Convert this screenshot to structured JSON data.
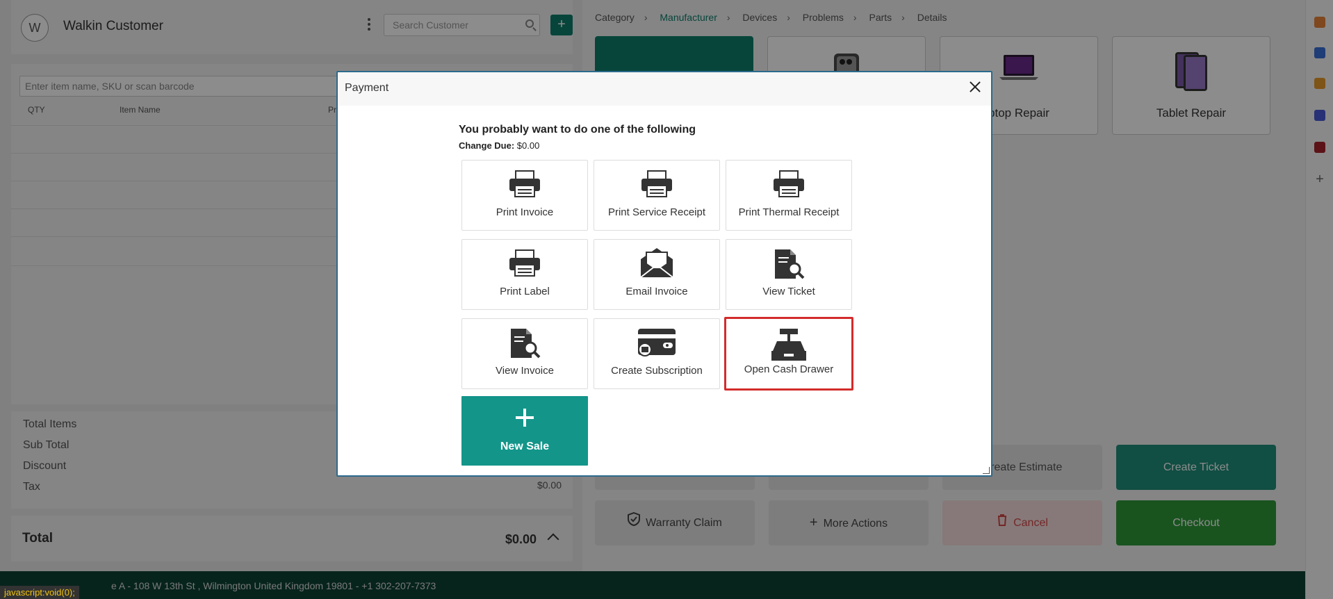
{
  "customer": {
    "avatar_initial": "W",
    "name": "Walkin Customer",
    "search_placeholder": "Search Customer",
    "add_label": "+"
  },
  "items": {
    "input_placeholder": "Enter item name, SKU or scan barcode",
    "columns": [
      "QTY",
      "Item Name",
      "Pr"
    ]
  },
  "totals": {
    "rows": [
      {
        "label": "Total Items",
        "value": ""
      },
      {
        "label": "Sub Total",
        "value": ""
      },
      {
        "label": "Discount",
        "value": ""
      },
      {
        "label": "Tax",
        "value": "$0.00"
      }
    ],
    "total_label": "Total",
    "total_value": "$0.00"
  },
  "breadcrumbs": [
    "Category",
    "Manufacturer",
    "Devices",
    "Problems",
    "Parts",
    "Details"
  ],
  "breadcrumb_active": "Manufacturer",
  "categories": [
    {
      "label": ""
    },
    {
      "label": ""
    },
    {
      "label": "ptop Repair"
    },
    {
      "label": "Tablet Repair"
    }
  ],
  "actions": {
    "create_estimate": "Create Estimate",
    "create_ticket": "Create Ticket",
    "warranty_claim": "Warranty Claim",
    "more_actions": "More Actions",
    "cancel": "Cancel",
    "checkout": "Checkout"
  },
  "footer": {
    "text": "e A - 108 W 13th St , Wilmington United Kingdom 19801 - +1 302-207-7373"
  },
  "status_bar": "javascript:void(0);",
  "modal": {
    "title": "Payment",
    "prompt": "You probably want to do one of the following",
    "change_due_label": "Change Due:",
    "change_due_value": "$0.00",
    "options": [
      {
        "label": "Print Invoice",
        "icon": "printer-icon"
      },
      {
        "label": "Print Service Receipt",
        "icon": "printer-icon"
      },
      {
        "label": "Print Thermal Receipt",
        "icon": "printer-icon"
      },
      {
        "label": "Print Label",
        "icon": "printer-icon"
      },
      {
        "label": "Email Invoice",
        "icon": "envelope-icon"
      },
      {
        "label": "View Ticket",
        "icon": "document-search-icon"
      },
      {
        "label": "View Invoice",
        "icon": "document-search-icon"
      },
      {
        "label": "Create Subscription",
        "icon": "credit-card-icon"
      },
      {
        "label": "Open Cash Drawer",
        "icon": "cash-register-icon"
      }
    ],
    "new_sale": "New Sale",
    "highlight_color": "#d32b2b"
  },
  "colors": {
    "brand": "#0d7f6c",
    "new_sale": "#13958a",
    "checkout": "#2e9a3a",
    "footer": "#0e4233"
  }
}
